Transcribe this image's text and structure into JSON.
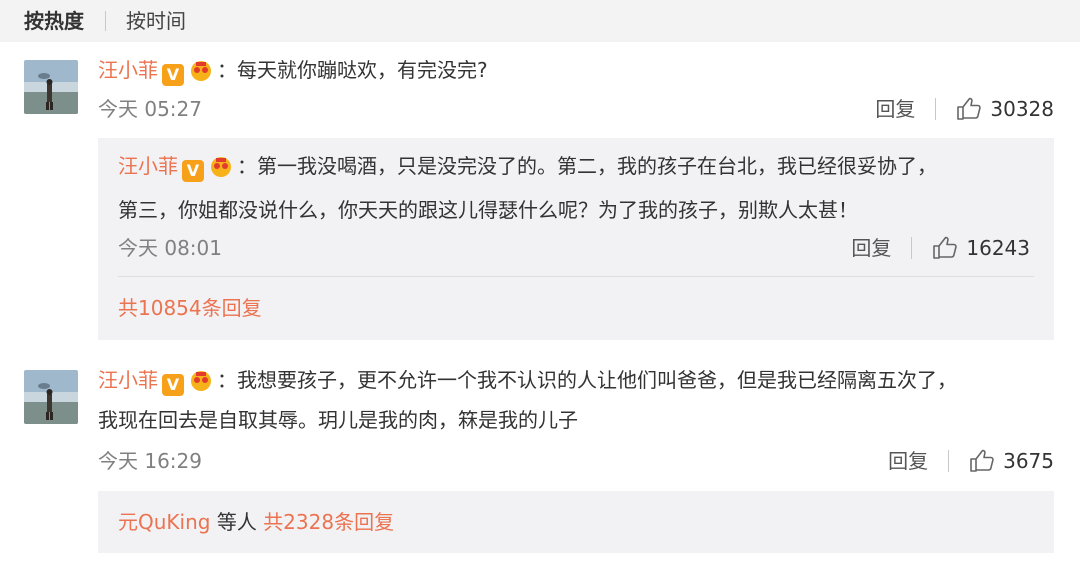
{
  "tabs": {
    "hot": "按热度",
    "time": "按时间"
  },
  "comments": [
    {
      "user": "汪小菲",
      "verified": "V",
      "text": "每天就你蹦哒欢，有完没完?",
      "time": "今天 05:27",
      "reply_label": "回复",
      "likes": "30328",
      "sub": {
        "user": "汪小菲",
        "verified": "V",
        "line1": "第一我没喝酒，只是没完没了的。第二，我的孩子在台北，我已经很妥协了，",
        "line2": "第三，你姐都没说什么，你天天的跟这儿得瑟什么呢？为了我的孩子，别欺人太甚！",
        "time": "今天 08:01",
        "reply_label": "回复",
        "likes": "16243"
      },
      "more": "共10854条回复"
    },
    {
      "user": "汪小菲",
      "verified": "V",
      "line1": "我想要孩子，更不允许一个我不认识的人让他们叫爸爸，但是我已经隔离五次了，",
      "line2": "我现在回去是自取其辱。玥儿是我的肉，箖是我的儿子",
      "time": "今天 16:29",
      "reply_label": "回复",
      "likes": "3675",
      "more_user": "元QuKing",
      "more_mid": " 等人 ",
      "more": "共2328条回复"
    }
  ],
  "colors": {
    "username": "#eb7350",
    "badge": "#f7a01a",
    "reply_bg": "#f2f2f5"
  },
  "icons": [
    "verified-badge",
    "vip-badge",
    "thumbs-up-icon"
  ]
}
